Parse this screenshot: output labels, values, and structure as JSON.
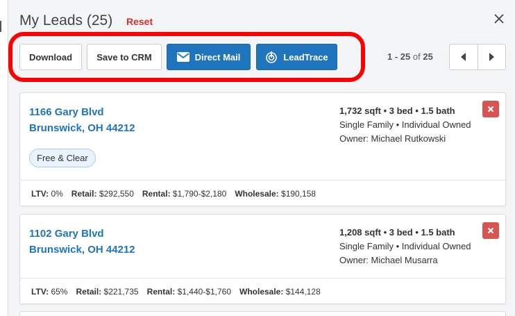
{
  "header": {
    "title": "My Leads (25)",
    "reset_label": "Reset"
  },
  "toolbar": {
    "download_label": "Download",
    "save_crm_label": "Save to CRM",
    "direct_mail_label": "Direct Mail",
    "leadtrace_label": "LeadTrace"
  },
  "pager": {
    "range": "1 - 25",
    "of": "of",
    "total": "25"
  },
  "leads": [
    {
      "street": "1166 Gary Blvd",
      "city": "Brunswick, OH 44212",
      "tag": "Free & Clear",
      "specs": "1,732 sqft • 3 bed • 1.5 bath",
      "type": "Single Family • Individual Owned",
      "owner": "Owner: Michael Rutkowski",
      "ltv_label": "LTV:",
      "ltv": "0%",
      "retail_label": "Retail:",
      "retail": "$292,550",
      "rental_label": "Rental:",
      "rental": "$1,790-$2,180",
      "wholesale_label": "Wholesale:",
      "wholesale": "$190,158"
    },
    {
      "street": "1102 Gary Blvd",
      "city": "Brunswick, OH 44212",
      "specs": "1,208 sqft • 3 bed • 1.5 bath",
      "type": "Single Family • Individual Owned",
      "owner": "Owner: Michael Musarra",
      "ltv_label": "LTV:",
      "ltv": "65%",
      "retail_label": "Retail:",
      "retail": "$221,735",
      "rental_label": "Rental:",
      "rental": "$1,440-$1,760",
      "wholesale_label": "Wholesale:",
      "wholesale": "$144,128"
    }
  ],
  "colors": {
    "accent": "#1e74bd",
    "danger": "#d9534f",
    "highlight": "#ff0000",
    "tag_bg": "#e8f3fb"
  }
}
